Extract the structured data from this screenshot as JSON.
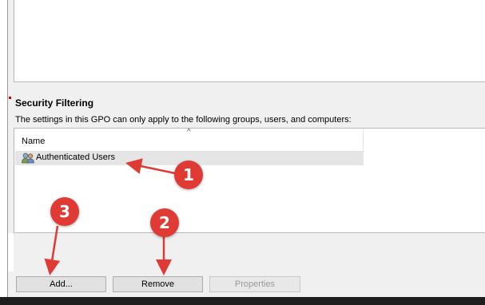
{
  "security_filtering": {
    "title": "Security Filtering",
    "description": "The settings in this GPO can only apply to the following groups, users, and computers:",
    "columns": [
      "Name"
    ],
    "rows": [
      {
        "name": "Authenticated Users",
        "icon": "users-icon"
      }
    ],
    "sort_indicator": "^"
  },
  "buttons": {
    "add": "Add...",
    "remove": "Remove",
    "properties": "Properties"
  },
  "callouts": [
    "1",
    "2",
    "3"
  ],
  "colors": {
    "callout": "#e03a35",
    "selected_row": "#e5e5e5",
    "bottom_bar": "#1e1e1e"
  }
}
